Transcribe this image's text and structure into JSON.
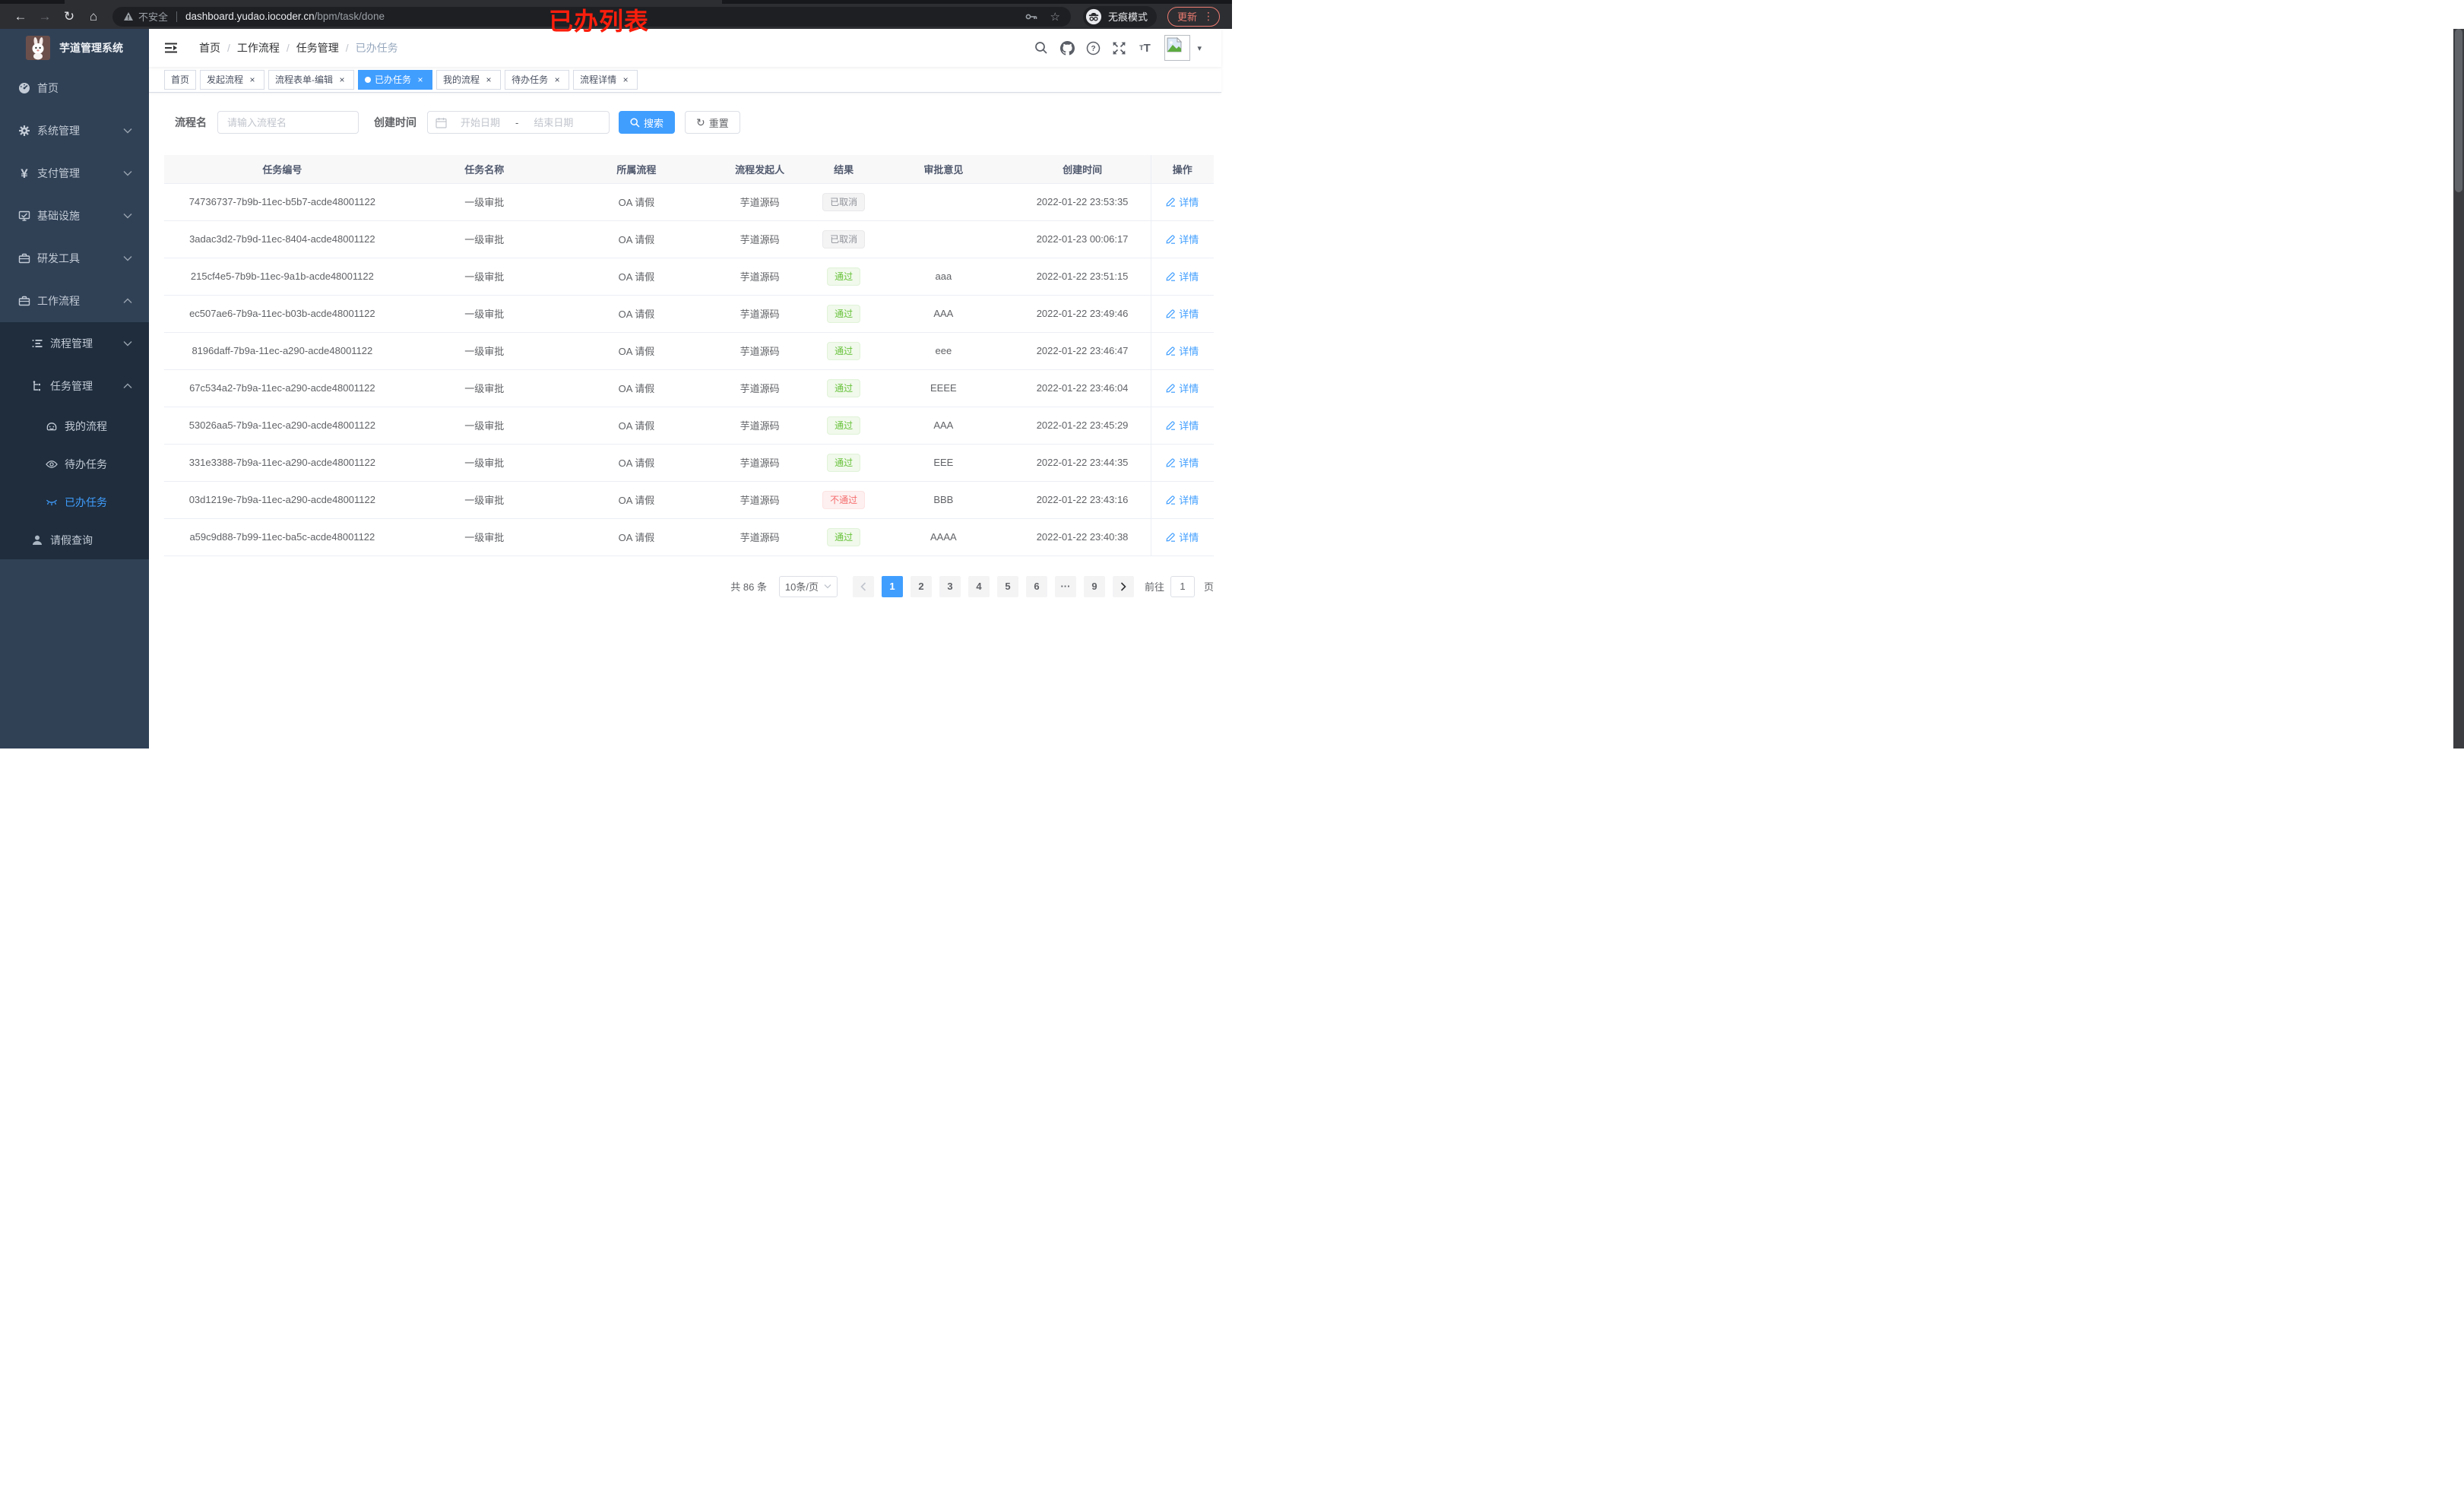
{
  "browser": {
    "url": {
      "warning_text": "不安全",
      "domain": "dashboard.yudao.iocoder.cn",
      "path": "/bpm/task/done"
    },
    "incognito_label": "无痕模式",
    "update_label": "更新"
  },
  "annotation": {
    "text": "已办列表",
    "color": "#fb1e0c"
  },
  "icons": {
    "close": "×",
    "back": "←",
    "forward": "→",
    "reload": "↻",
    "home": "⌂",
    "star": "☆",
    "more_vertical": "⋮",
    "caret_down": "▾",
    "breadcrumb_sep": "/",
    "reset_glyph": "↻"
  },
  "sidebar": {
    "title": "芋道管理系统",
    "items": [
      {
        "label": "首页",
        "icon": "dashboard-icon"
      },
      {
        "label": "系统管理",
        "icon": "gear-icon"
      },
      {
        "label": "支付管理",
        "icon": "yen-icon"
      },
      {
        "label": "基础设施",
        "icon": "monitor-icon"
      },
      {
        "label": "研发工具",
        "icon": "toolbox-icon"
      },
      {
        "label": "工作流程",
        "icon": "toolbox-icon",
        "expanded": true
      }
    ],
    "workflow_children": [
      {
        "label": "流程管理",
        "icon": "list-icon"
      },
      {
        "label": "任务管理",
        "icon": "flow-icon",
        "expanded": true,
        "children": [
          {
            "label": "我的流程",
            "icon": "robot-icon"
          },
          {
            "label": "待办任务",
            "icon": "eye-icon"
          },
          {
            "label": "已办任务",
            "icon": "eye-closed-icon",
            "active": true
          }
        ]
      },
      {
        "label": "请假查询",
        "icon": "user-icon"
      }
    ]
  },
  "navbar": {
    "breadcrumb": [
      "首页",
      "工作流程",
      "任务管理",
      "已办任务"
    ]
  },
  "tabs": [
    {
      "label": "首页",
      "closable": false,
      "active": false
    },
    {
      "label": "发起流程",
      "closable": true,
      "active": false
    },
    {
      "label": "流程表单-编辑",
      "closable": true,
      "active": false
    },
    {
      "label": "已办任务",
      "closable": true,
      "active": true
    },
    {
      "label": "我的流程",
      "closable": true,
      "active": false
    },
    {
      "label": "待办任务",
      "closable": true,
      "active": false
    },
    {
      "label": "流程详情",
      "closable": true,
      "active": false
    }
  ],
  "filters": {
    "name_label": "流程名",
    "name_placeholder": "请输入流程名",
    "time_label": "创建时间",
    "start_placeholder": "开始日期",
    "separator": "-",
    "end_placeholder": "结束日期",
    "search_label": "搜索",
    "reset_label": "重置"
  },
  "table": {
    "columns": [
      "任务编号",
      "任务名称",
      "所属流程",
      "流程发起人",
      "结果",
      "审批意见",
      "创建时间",
      "操作"
    ],
    "action_label": "详情",
    "rows": [
      {
        "id": "74736737-7b9b-11ec-b5b7-acde48001122",
        "name": "一级审批",
        "process": "OA 请假",
        "starter": "芋道源码",
        "result": "已取消",
        "result_type": "info",
        "comment": "",
        "created": "2022-01-22 23:53:35"
      },
      {
        "id": "3adac3d2-7b9d-11ec-8404-acde48001122",
        "name": "一级审批",
        "process": "OA 请假",
        "starter": "芋道源码",
        "result": "已取消",
        "result_type": "info",
        "comment": "",
        "created": "2022-01-23 00:06:17"
      },
      {
        "id": "215cf4e5-7b9b-11ec-9a1b-acde48001122",
        "name": "一级审批",
        "process": "OA 请假",
        "starter": "芋道源码",
        "result": "通过",
        "result_type": "success",
        "comment": "aaa",
        "created": "2022-01-22 23:51:15"
      },
      {
        "id": "ec507ae6-7b9a-11ec-b03b-acde48001122",
        "name": "一级审批",
        "process": "OA 请假",
        "starter": "芋道源码",
        "result": "通过",
        "result_type": "success",
        "comment": "AAA",
        "created": "2022-01-22 23:49:46"
      },
      {
        "id": "8196daff-7b9a-11ec-a290-acde48001122",
        "name": "一级审批",
        "process": "OA 请假",
        "starter": "芋道源码",
        "result": "通过",
        "result_type": "success",
        "comment": "eee",
        "created": "2022-01-22 23:46:47"
      },
      {
        "id": "67c534a2-7b9a-11ec-a290-acde48001122",
        "name": "一级审批",
        "process": "OA 请假",
        "starter": "芋道源码",
        "result": "通过",
        "result_type": "success",
        "comment": "EEEE",
        "created": "2022-01-22 23:46:04"
      },
      {
        "id": "53026aa5-7b9a-11ec-a290-acde48001122",
        "name": "一级审批",
        "process": "OA 请假",
        "starter": "芋道源码",
        "result": "通过",
        "result_type": "success",
        "comment": "AAA",
        "created": "2022-01-22 23:45:29"
      },
      {
        "id": "331e3388-7b9a-11ec-a290-acde48001122",
        "name": "一级审批",
        "process": "OA 请假",
        "starter": "芋道源码",
        "result": "通过",
        "result_type": "success",
        "comment": "EEE",
        "created": "2022-01-22 23:44:35"
      },
      {
        "id": "03d1219e-7b9a-11ec-a290-acde48001122",
        "name": "一级审批",
        "process": "OA 请假",
        "starter": "芋道源码",
        "result": "不通过",
        "result_type": "danger",
        "comment": "BBB",
        "created": "2022-01-22 23:43:16"
      },
      {
        "id": "a59c9d88-7b99-11ec-ba5c-acde48001122",
        "name": "一级审批",
        "process": "OA 请假",
        "starter": "芋道源码",
        "result": "通过",
        "result_type": "success",
        "comment": "AAAA",
        "created": "2022-01-22 23:40:38"
      }
    ]
  },
  "pagination": {
    "total_text": "共 86 条",
    "page_size": "10条/页",
    "items": [
      {
        "label": "1",
        "active": true
      },
      {
        "label": "2"
      },
      {
        "label": "3"
      },
      {
        "label": "4"
      },
      {
        "label": "5"
      },
      {
        "label": "6"
      },
      {
        "label": "···",
        "type": "more"
      },
      {
        "label": "9"
      }
    ],
    "goto_label": "前往",
    "goto_value": "1",
    "goto_suffix": "页"
  },
  "colors": {
    "primary": "#409eff",
    "success": "#67c23a",
    "danger": "#f56c6c",
    "info": "#909399",
    "sidebar": "#304156",
    "submenu": "#1f2d3d"
  }
}
